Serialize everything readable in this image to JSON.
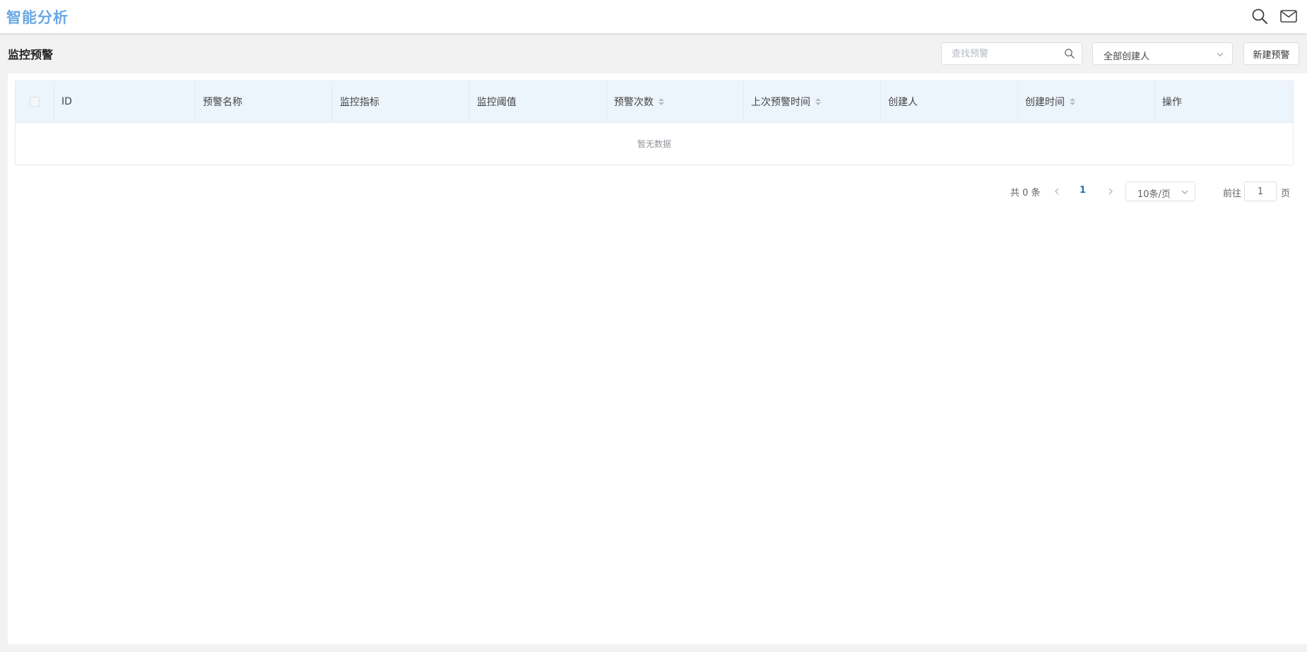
{
  "header": {
    "app_title": "智能分析",
    "icons": [
      "search-icon",
      "mail-icon"
    ]
  },
  "page": {
    "title": "监控预警"
  },
  "toolbar": {
    "search_placeholder": "查找预警",
    "search_value": "",
    "creator_filter_value": "全部创建人",
    "new_button_label": "新建预警"
  },
  "table": {
    "columns": [
      {
        "label": "",
        "sortable": false
      },
      {
        "label": "ID",
        "sortable": false
      },
      {
        "label": "预警名称",
        "sortable": false
      },
      {
        "label": "监控指标",
        "sortable": false
      },
      {
        "label": "监控阈值",
        "sortable": false
      },
      {
        "label": "预警次数",
        "sortable": true
      },
      {
        "label": "上次预警时间",
        "sortable": true
      },
      {
        "label": "创建人",
        "sortable": false
      },
      {
        "label": "创建时间",
        "sortable": true
      },
      {
        "label": "操作",
        "sortable": false
      }
    ],
    "rows": [],
    "empty_text": "暂无数据"
  },
  "pagination": {
    "total_label": "共 0 条",
    "current_page": "1",
    "page_size_label": "10条/页",
    "goto_label": "前往",
    "goto_value": "1",
    "goto_suffix": "页"
  },
  "colors": {
    "brand": "#6aa8e4",
    "header_bg": "#ecf4fc",
    "active_page": "#2a6fb0"
  }
}
